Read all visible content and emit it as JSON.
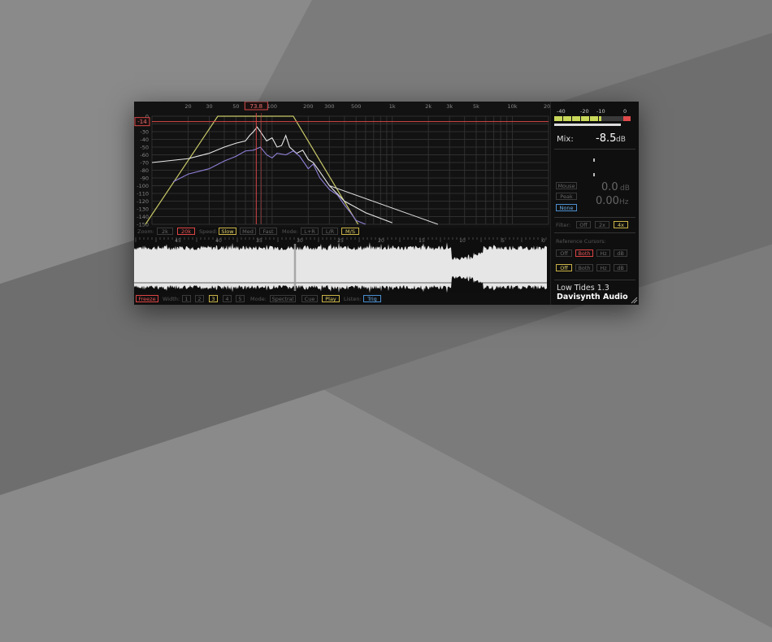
{
  "spectrum": {
    "freq_labels": [
      {
        "f": 20,
        "t": "20"
      },
      {
        "f": 30,
        "t": "30"
      },
      {
        "f": 50,
        "t": "50"
      },
      {
        "f": 100,
        "t": "100"
      },
      {
        "f": 200,
        "t": "200"
      },
      {
        "f": 300,
        "t": "300"
      },
      {
        "f": 500,
        "t": "500"
      },
      {
        "f": 1000,
        "t": "1k"
      },
      {
        "f": 2000,
        "t": "2k"
      },
      {
        "f": 3000,
        "t": "3k"
      },
      {
        "f": 5000,
        "t": "5k"
      },
      {
        "f": 10000,
        "t": "10k"
      },
      {
        "f": 20000,
        "t": "20k"
      }
    ],
    "db_labels": [
      "0",
      "-20",
      "-30",
      "-40",
      "-50",
      "-60",
      "-70",
      "-80",
      "-90",
      "-100",
      "-110",
      "-120",
      "-130",
      "-140",
      "-150"
    ],
    "cursor_freq": "73.8",
    "cursor_db": "-14",
    "colors": {
      "filter": "#c9c96a",
      "white": "#e8e8e8",
      "purple": "#8f7fd6",
      "cursor": "#d84848",
      "grid": "#2f2f2f"
    }
  },
  "controls_top": {
    "zoom_label": "Zoom:",
    "zoom_2k": "2k",
    "zoom_20k": "20k",
    "speed_label": "Speed:",
    "speed_slow": "Slow",
    "speed_med": "Med",
    "speed_fast": "Fast",
    "mode_label": "Mode:",
    "mode_lr": "L+R",
    "mode_l_r": "L/R",
    "mode_ms": "M/S"
  },
  "waveform": {
    "time_labels": [
      "45",
      "40",
      "35",
      "30",
      "25",
      "20",
      "15",
      "10",
      "5",
      "0"
    ]
  },
  "controls_bottom": {
    "freeze": "Freeze",
    "width_label": "Width:",
    "w1": "1",
    "w2": "2",
    "w3": "3",
    "w4": "4",
    "w5": "5",
    "mode_label": "Mode:",
    "spectral": "Spectral",
    "cue": "Cue",
    "play": "Play",
    "listen_label": "Listen:",
    "trig": "Trig"
  },
  "meter": {
    "labels": [
      "-40",
      "-20",
      "-10",
      "0"
    ]
  },
  "mix": {
    "label": "Mix:",
    "value": "-8.5",
    "unit": "dB"
  },
  "readout": {
    "db": "0.0",
    "db_unit": "dB",
    "hz": "0.00",
    "hz_unit": "Hz",
    "mouse": "Mouse",
    "peak": "Peak",
    "none": "None"
  },
  "filter": {
    "label": "Filter:",
    "off": "Off",
    "x2": "2x",
    "x4": "4x"
  },
  "ref": {
    "label": "Reference Cursors:",
    "off": "Off",
    "both": "Both",
    "hz": "Hz",
    "db": "dB"
  },
  "brand": {
    "product": "Low Tides 1.3",
    "company": "Davisynth Audio"
  }
}
